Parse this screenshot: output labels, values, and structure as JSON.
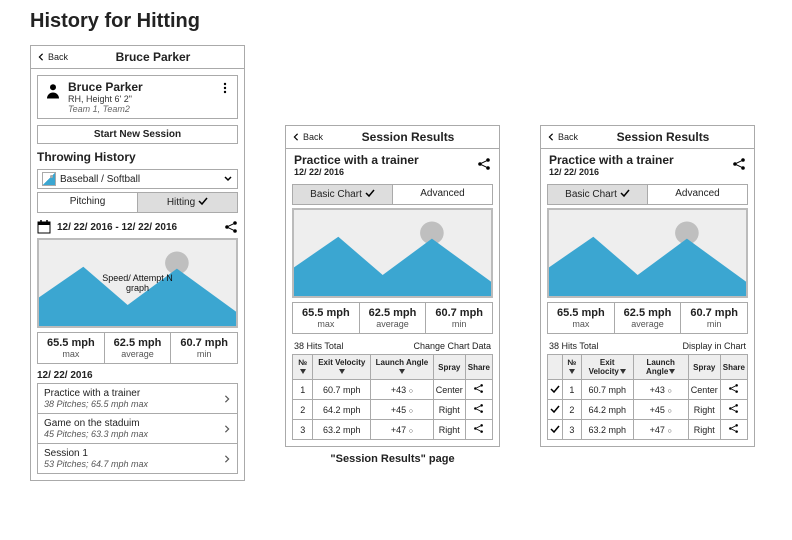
{
  "page_title": "History for Hitting",
  "phone1": {
    "nav": {
      "back": "Back",
      "title": "Bruce Parker"
    },
    "profile": {
      "name": "Bruce Parker",
      "sub": "RH, Height   6' 2\"",
      "teams": "Team 1, Team2"
    },
    "start_btn": "Start New Session",
    "section": "Throwing History",
    "sport": "Baseball / Softball",
    "tabs": {
      "pitching": "Pitching",
      "hitting": "Hitting"
    },
    "date_range": "12/ 22/ 2016 - 12/ 22/ 2016",
    "chart_label": "Speed/ Attempt N\ngraph",
    "stats": {
      "max": {
        "v": "65.5 mph",
        "l": "max"
      },
      "avg": {
        "v": "62.5 mph",
        "l": "average"
      },
      "min": {
        "v": "60.7 mph",
        "l": "min"
      }
    },
    "date_hdr": "12/ 22/ 2016",
    "sessions": [
      {
        "t": "Practice with a trainer",
        "s": "38 Pitches; 65.5 mph max"
      },
      {
        "t": "Game on the staduim",
        "s": "45 Pitches; 63.3 mph max"
      },
      {
        "t": "Session 1",
        "s": "53 Pitches; 64.7 mph max"
      }
    ]
  },
  "phone2": {
    "nav": {
      "back": "Back",
      "title": "Session Results"
    },
    "title": "Practice with a trainer",
    "date": "12/ 22/ 2016",
    "tabs": {
      "basic": "Basic Chart",
      "adv": "Advanced"
    },
    "stats": {
      "max": {
        "v": "65.5 mph",
        "l": "max"
      },
      "avg": {
        "v": "62.5 mph",
        "l": "average"
      },
      "min": {
        "v": "60.7 mph",
        "l": "min"
      }
    },
    "total": "38 Hits Total",
    "link": "Change Chart Data",
    "cols": {
      "n": "№",
      "ev": "Exit Velocity",
      "la": "Launch Angle",
      "sp": "Spray",
      "sh": "Share"
    },
    "rows": [
      {
        "n": "1",
        "ev": "60.7 mph",
        "la": "+43",
        "sp": "Center"
      },
      {
        "n": "2",
        "ev": "64.2 mph",
        "la": "+45",
        "sp": "Right"
      },
      {
        "n": "3",
        "ev": "63.2 mph",
        "la": "+47",
        "sp": "Right"
      }
    ],
    "caption": "\"Session Results\" page"
  },
  "phone3": {
    "nav": {
      "back": "Back",
      "title": "Session Results"
    },
    "title": "Practice with a trainer",
    "date": "12/ 22/ 2016",
    "tabs": {
      "basic": "Basic Chart",
      "adv": "Advanced"
    },
    "stats": {
      "max": {
        "v": "65.5 mph",
        "l": "max"
      },
      "avg": {
        "v": "62.5 mph",
        "l": "average"
      },
      "min": {
        "v": "60.7 mph",
        "l": "min"
      }
    },
    "total": "38 Hits Total",
    "link": "Display in Chart",
    "cols": {
      "n": "№",
      "ev": "Exit Velocity",
      "la": "Launch Angle",
      "sp": "Spray",
      "sh": "Share"
    },
    "rows": [
      {
        "n": "1",
        "ev": "60.7 mph",
        "la": "+43",
        "sp": "Center"
      },
      {
        "n": "2",
        "ev": "64.2 mph",
        "la": "+45",
        "sp": "Right"
      },
      {
        "n": "3",
        "ev": "63.2 mph",
        "la": "+47",
        "sp": "Right"
      }
    ]
  }
}
